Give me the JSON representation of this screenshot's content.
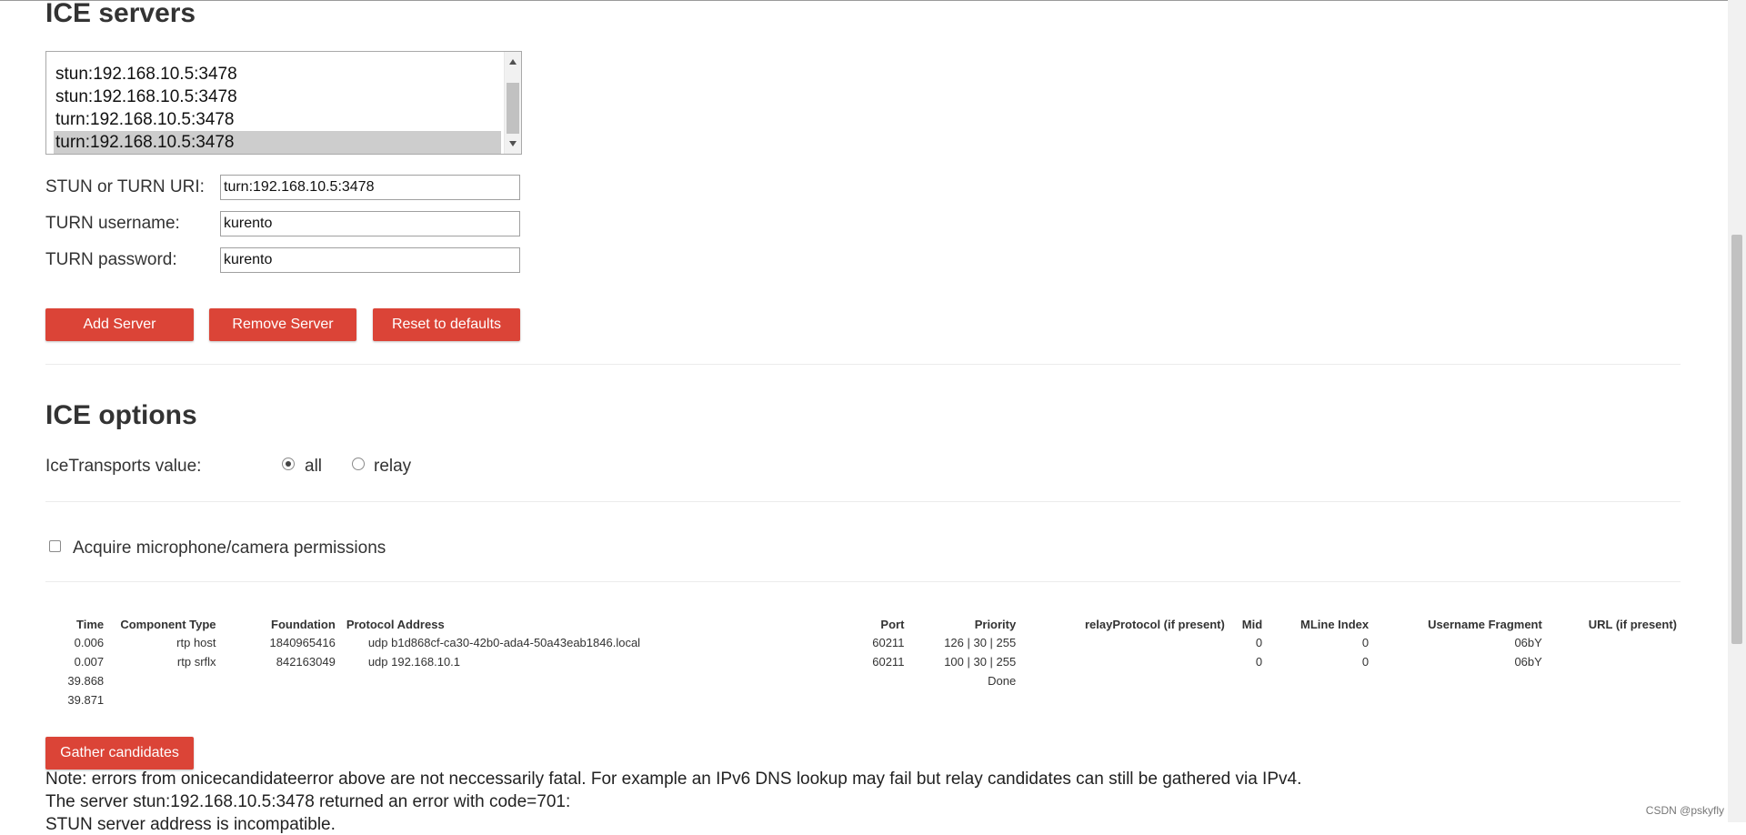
{
  "ice_servers": {
    "heading": "ICE servers",
    "list_items": [
      {
        "label": "stun:192.168.10.5:3478",
        "selected": false
      },
      {
        "label": "stun:192.168.10.5:3478",
        "selected": false
      },
      {
        "label": "turn:192.168.10.5:3478",
        "selected": false
      },
      {
        "label": "turn:192.168.10.5:3478",
        "selected": true
      }
    ],
    "uri_label": "STUN or TURN URI:",
    "uri_value": "turn:192.168.10.5:3478",
    "username_label": "TURN username:",
    "username_value": "kurento",
    "password_label": "TURN password:",
    "password_value": "kurento",
    "add_button": "Add Server",
    "remove_button": "Remove Server",
    "reset_button": "Reset to defaults"
  },
  "ice_options": {
    "heading": "ICE options",
    "transports_label": "IceTransports value:",
    "option_all": "all",
    "option_relay": "relay",
    "selected": "all"
  },
  "permissions": {
    "label": "Acquire microphone/camera permissions",
    "checked": false
  },
  "candidates": {
    "columns": [
      "Time",
      "Component Type",
      "Foundation",
      "Protocol Address",
      "Port",
      "Priority",
      "relayProtocol (if present)",
      "Mid",
      "MLine Index",
      "Username Fragment",
      "URL (if present)"
    ],
    "rows": [
      [
        "0.006",
        "rtp host",
        "1840965416",
        "udp b1d868cf-ca30-42b0-ada4-50a43eab1846.local",
        "60211",
        "126 | 30 | 255",
        "",
        "0",
        "0",
        "06bY",
        ""
      ],
      [
        "0.007",
        "rtp srflx",
        "842163049",
        "udp 192.168.10.1",
        "60211",
        "100 | 30 | 255",
        "",
        "0",
        "0",
        "06bY",
        ""
      ],
      [
        "39.868",
        "",
        "",
        "",
        "",
        "Done",
        "",
        "",
        "",
        "",
        ""
      ],
      [
        "39.871",
        "",
        "",
        "",
        "",
        "",
        "",
        "",
        "",
        "",
        ""
      ]
    ]
  },
  "gather_button": "Gather candidates",
  "notes": [
    "Note: errors from onicecandidateerror above are not neccessarily fatal. For example an IPv6 DNS lookup may fail but relay candidates can still be gathered via IPv4.",
    "The server stun:192.168.10.5:3478 returned an error with code=701:",
    "STUN server address is incompatible."
  ],
  "watermark": "CSDN @pskyfly"
}
